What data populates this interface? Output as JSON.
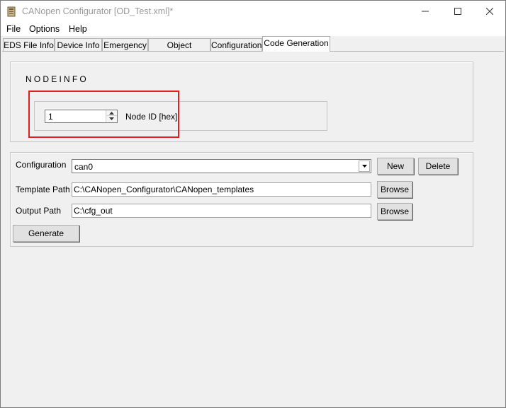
{
  "window": {
    "title": "CANopen Configurator [OD_Test.xml]*",
    "min_glyph": "—",
    "max_glyph": "☐",
    "close_glyph": "✕"
  },
  "menu": {
    "items": [
      {
        "label": "File"
      },
      {
        "label": "Options"
      },
      {
        "label": "Help"
      }
    ]
  },
  "tabs": [
    {
      "label": "EDS File Info",
      "active": false
    },
    {
      "label": "Device Info",
      "active": false
    },
    {
      "label": "Emergency",
      "active": false
    },
    {
      "label": "Object Directory",
      "active": false
    },
    {
      "label": "Configuration",
      "active": false
    },
    {
      "label": "Code Generation",
      "active": true
    }
  ],
  "nodeinfo": {
    "group_label": "NODEINFO",
    "node_id_value": "1",
    "node_id_label": "Node ID [hex]"
  },
  "config": {
    "configuration_label": "Configuration",
    "configuration_value": "can0",
    "new_button": "New",
    "delete_button": "Delete",
    "template_path_label": "Template Path",
    "template_path_value": "C:\\CANopen_Configurator\\CANopen_templates",
    "output_path_label": "Output Path",
    "output_path_value": "C:\\cfg_out",
    "browse_button": "Browse",
    "generate_button": "Generate"
  },
  "colors": {
    "highlight": "#e02020",
    "panel_bg": "#f0f0f0"
  }
}
